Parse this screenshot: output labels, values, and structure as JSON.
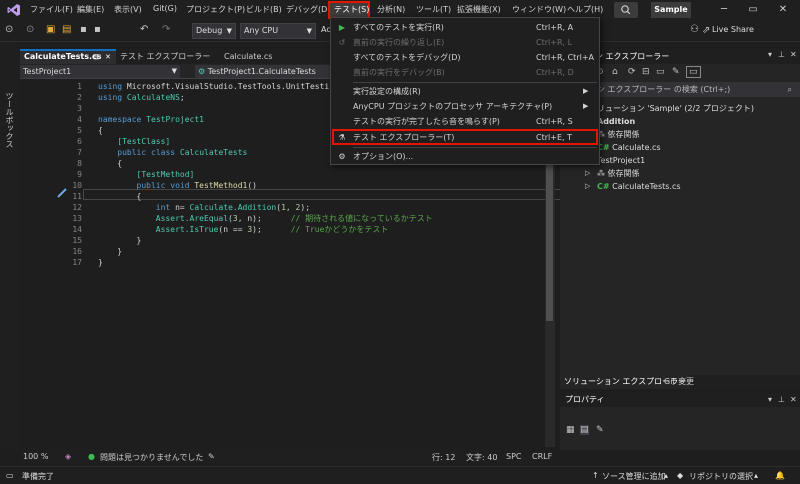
{
  "menubar": {
    "items": [
      "ファイル(F)",
      "編集(E)",
      "表示(V)",
      "Git(G)",
      "プロジェクト(P)",
      "ビルド(B)",
      "デバッグ(D)",
      "テスト(S)",
      "分析(N)",
      "ツール(T)",
      "拡張機能(X)",
      "ウィンドウ(W)",
      "ヘルプ(H)"
    ],
    "solution_name": "Sample"
  },
  "toolbar": {
    "config": "Debug",
    "platform": "Any CPU",
    "start_partial": "Ac",
    "live_share": "Live Share"
  },
  "toolbox": {
    "label": "ツールボックス"
  },
  "editor": {
    "tabs": [
      "CalculateTests.cs",
      "テスト エクスプローラー",
      "Calculate.cs"
    ],
    "nav_left": "TestProject1",
    "nav_right": "TestProject1.CalculateTests",
    "code": [
      {
        "n": "1",
        "t": "using Microsoft.VisualStudio.TestTools.UnitTesting;"
      },
      {
        "n": "2",
        "t": "using CalculateNS;"
      },
      {
        "n": "3",
        "t": ""
      },
      {
        "n": "4",
        "t": "namespace TestProject1"
      },
      {
        "n": "5",
        "t": "{"
      },
      {
        "n": "6",
        "t": "    [TestClass]"
      },
      {
        "n": "7",
        "t": "    public class CalculateTests"
      },
      {
        "n": "8",
        "t": "    {"
      },
      {
        "n": "9",
        "t": "        [TestMethod]"
      },
      {
        "n": "10",
        "t": "        public void TestMethod1()"
      },
      {
        "n": "11",
        "t": "        {"
      },
      {
        "n": "12",
        "t": "            int n= Calculate.Addition(1, 2);"
      },
      {
        "n": "13",
        "t": "            Assert.AreEqual(3, n);      // 期待される値になっているかテスト"
      },
      {
        "n": "14",
        "t": "            Assert.IsTrue(n == 3);      // Trueかどうかをテスト"
      },
      {
        "n": "15",
        "t": "        }"
      },
      {
        "n": "16",
        "t": "    }"
      },
      {
        "n": "17",
        "t": "}"
      }
    ],
    "status": {
      "zoom": "100 %",
      "issues": "問題は見つかりませんでした",
      "line": "行: 12",
      "col": "文字: 40",
      "spc": "SPC",
      "eol": "CRLF"
    }
  },
  "test_menu": {
    "items": [
      {
        "label": "すべてのテストを実行(R)",
        "shortcut": "Ctrl+R, A",
        "disabled": false
      },
      {
        "label": "直前の実行の繰り返し(E)",
        "shortcut": "Ctrl+R, L",
        "disabled": true
      },
      {
        "label": "すべてのテストをデバッグ(D)",
        "shortcut": "Ctrl+R, Ctrl+A",
        "disabled": false
      },
      {
        "label": "直前の実行をデバッグ(B)",
        "shortcut": "Ctrl+R, D",
        "disabled": true
      },
      {
        "label": "実行設定の構成(R)",
        "shortcut": "",
        "disabled": false
      },
      {
        "label": "AnyCPU プロジェクトのプロセッサ アーキテクチャ(P)",
        "shortcut": "",
        "disabled": false
      },
      {
        "label": "テストの実行が完了したら音を鳴らす(P)",
        "shortcut": "Ctrl+R, S",
        "disabled": false
      },
      {
        "label": "テスト エクスプローラー(T)",
        "shortcut": "Ctrl+E, T",
        "disabled": false
      },
      {
        "label": "オプション(O)...",
        "shortcut": "",
        "disabled": false
      }
    ]
  },
  "solution_explorer": {
    "title": "ン エクスプローラー",
    "search": "ン エクスプローラー の検索 (Ctrl+;)",
    "tree": [
      {
        "label": "リューション 'Sample' (2/2 プロジェクト)"
      },
      {
        "label": "Addition"
      },
      {
        "label": "依存関係"
      },
      {
        "label": "Calculate.cs"
      },
      {
        "label": "TestProject1"
      },
      {
        "label": "依存関係"
      },
      {
        "label": "CalculateTests.cs"
      }
    ],
    "tabs": [
      "ソリューション エクスプローラー",
      "Git 変更"
    ]
  },
  "properties": {
    "title": "プロパティ"
  },
  "statusbar": {
    "ready": "準備完了",
    "source_control": "ソース管理に追加",
    "repo": "リポジトリの選択"
  },
  "colors": {
    "highlight": "#e51400",
    "accent": "#0e70c0",
    "success": "#3fb950"
  }
}
